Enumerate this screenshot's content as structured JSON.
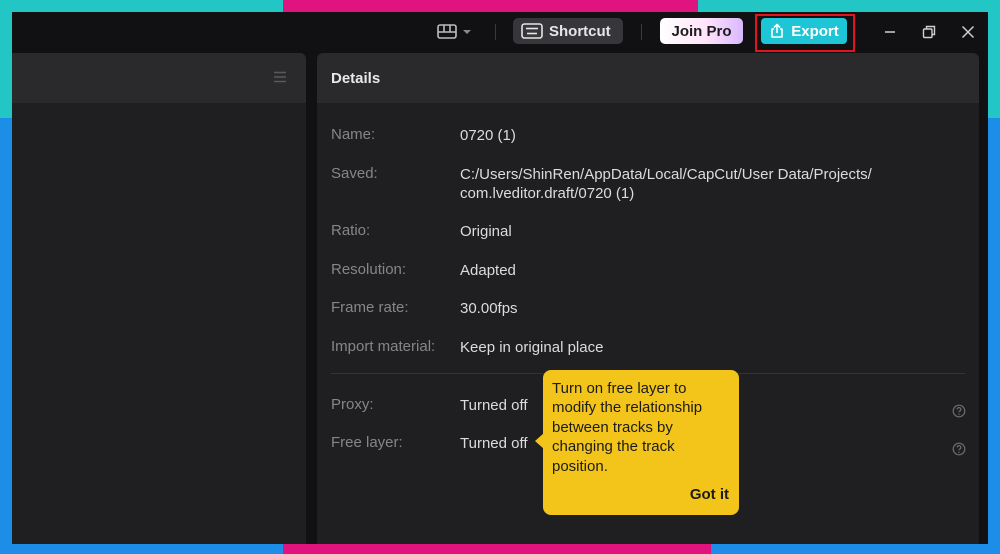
{
  "toolbar": {
    "shortcut_label": "Shortcut",
    "join_pro_label": "Join Pro",
    "export_label": "Export"
  },
  "details": {
    "title": "Details",
    "rows": [
      {
        "label": "Name:",
        "value": "0720 (1)"
      },
      {
        "label": "Saved:",
        "value": "C:/Users/ShinRen/AppData/Local/CapCut/User Data/Projects/",
        "value2": "com.lveditor.draft/0720 (1)"
      },
      {
        "label": "Ratio:",
        "value": "Original"
      },
      {
        "label": "Resolution:",
        "value": "Adapted"
      },
      {
        "label": "Frame rate:",
        "value": "30.00fps"
      },
      {
        "label": "Import material:",
        "value": "Keep in original place"
      },
      {
        "label": "Proxy:",
        "value": "Turned off"
      },
      {
        "label": "Free layer:",
        "value": "Turned off"
      }
    ]
  },
  "tooltip": {
    "message": "Turn on free layer to modify the relationship between tracks by changing the track position.",
    "action_label": "Got it"
  },
  "colors": {
    "accent_export": "#1ec5d6",
    "highlight_box": "#e3151c",
    "tooltip_bg": "#f3c51a"
  },
  "icons": [
    "layout-icon",
    "chevron-down-icon",
    "keyboard-icon",
    "export-icon",
    "minimize-icon",
    "restore-icon",
    "close-icon",
    "menu-icon",
    "help-icon"
  ]
}
